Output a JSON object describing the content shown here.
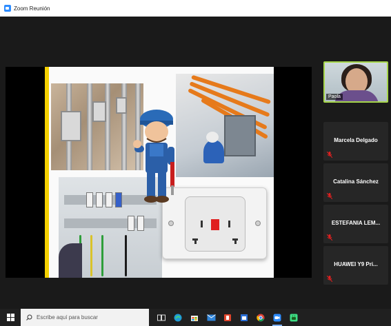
{
  "window": {
    "title": "Zoom Reunión"
  },
  "participants": [
    {
      "name": "Paola",
      "video": true
    },
    {
      "name": "Marcela Delgado",
      "muted": true
    },
    {
      "name": "Catalina Sánchez",
      "muted": true
    },
    {
      "name": "ESTEFANIA LEM...",
      "muted": true
    },
    {
      "name": "HUAWEI Y9 Pri...",
      "muted": true
    }
  ],
  "taskbar": {
    "search_placeholder": "Escribe aquí para buscar",
    "icons": [
      "task-view-icon",
      "edge-icon",
      "store-icon",
      "mail-icon",
      "office-icon",
      "calendar-icon",
      "chrome-icon",
      "zoom-icon",
      "android-icon"
    ]
  },
  "colors": {
    "active_speaker_border": "#a6d64a",
    "mic_muted": "#e02020",
    "zoom_blue": "#2d8cff"
  }
}
